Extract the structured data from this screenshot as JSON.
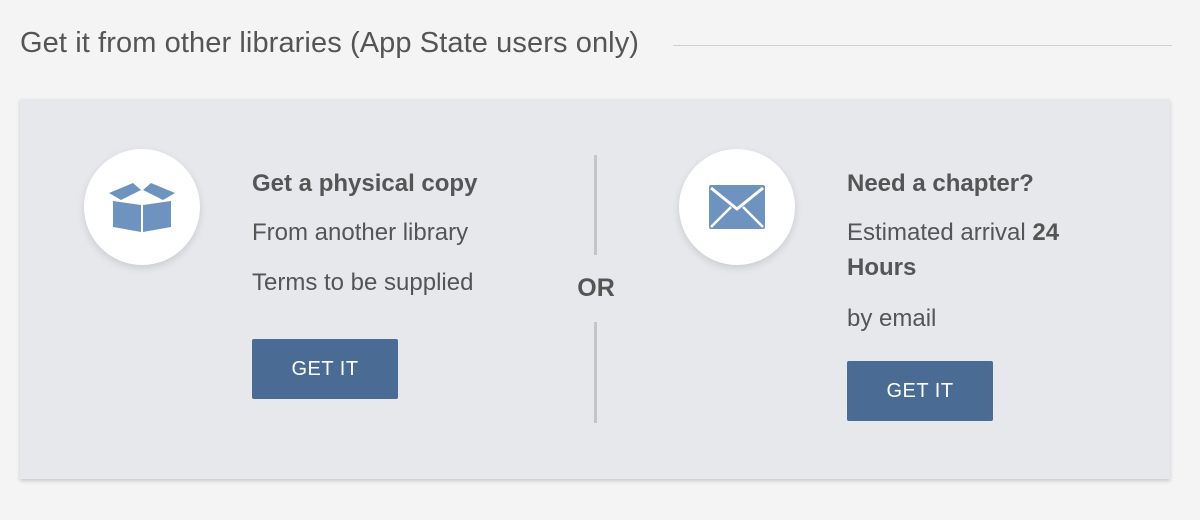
{
  "section": {
    "title": "Get it from other libraries (App State users only)"
  },
  "physical": {
    "icon": "box-icon",
    "title": "Get a physical copy",
    "line1": "From another library",
    "line2": "Terms to be supplied",
    "button_label": "GET IT"
  },
  "divider": {
    "label": "OR"
  },
  "chapter": {
    "icon": "envelope-icon",
    "title": "Need a chapter?",
    "arrival_prefix": "Estimated arrival",
    "arrival_value_1": "24",
    "arrival_value_2": "Hours",
    "delivery": "by email",
    "button_label": "GET IT"
  },
  "colors": {
    "accent": "#4a6b94",
    "icon": "#6f93bf",
    "panel": "#e6e8ec",
    "page": "#f4f4f4"
  }
}
